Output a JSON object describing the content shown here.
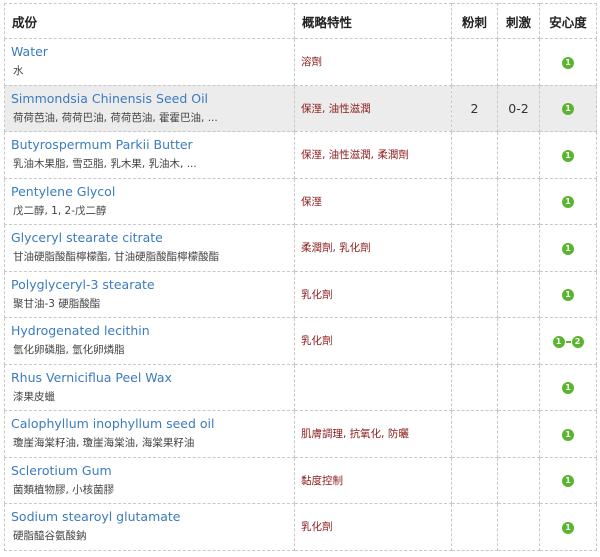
{
  "headers": {
    "ingredient": "成份",
    "properties": "概略特性",
    "acne": "粉刺",
    "irritation": "刺激",
    "safety": "安心度"
  },
  "rows": [
    {
      "name": "Water",
      "alias": "水",
      "props": "溶劑",
      "acne": "",
      "irritation": "",
      "safety": "1",
      "safety_to": ""
    },
    {
      "name": "Simmondsia Chinensis Seed Oil",
      "alias": "荷荷芭油, 荷荷巴油, 荷荷芭油, 霍霍巴油, ...",
      "props": "保溼, 油性滋潤",
      "acne": "2",
      "irritation": "0-2",
      "safety": "1",
      "safety_to": ""
    },
    {
      "name": "Butyrospermum Parkii Butter",
      "alias": "乳油木果脂, 雪亞脂, 乳木果, 乳油木, ...",
      "props": "保溼, 油性滋潤, 柔潤劑",
      "acne": "",
      "irritation": "",
      "safety": "1",
      "safety_to": ""
    },
    {
      "name": "Pentylene Glycol",
      "alias": "戊二醇, 1, 2-戊二醇",
      "props": "保溼",
      "acne": "",
      "irritation": "",
      "safety": "1",
      "safety_to": ""
    },
    {
      "name": "Glyceryl stearate citrate",
      "alias": "甘油硬脂酸酯檸檬酯, 甘油硬脂酸酯檸檬酸酯",
      "props": "柔潤劑, 乳化劑",
      "acne": "",
      "irritation": "",
      "safety": "1",
      "safety_to": ""
    },
    {
      "name": "Polyglyceryl-3 stearate",
      "alias": "聚甘油-3 硬脂酸酯",
      "props": "乳化劑",
      "acne": "",
      "irritation": "",
      "safety": "1",
      "safety_to": ""
    },
    {
      "name": "Hydrogenated lecithin",
      "alias": "氫化卵磷脂, 氫化卵燐脂",
      "props": "乳化劑",
      "acne": "",
      "irritation": "",
      "safety": "1",
      "safety_to": "2"
    },
    {
      "name": "Rhus Verniciflua Peel Wax",
      "alias": "漆果皮蠟",
      "props": "",
      "acne": "",
      "irritation": "",
      "safety": "1",
      "safety_to": ""
    },
    {
      "name": "Calophyllum inophyllum seed oil",
      "alias": "瓊崖海棠籽油, 瓊崖海棠油, 海棠果籽油",
      "props": "肌膚調理, 抗氧化, 防曬",
      "acne": "",
      "irritation": "",
      "safety": "1",
      "safety_to": ""
    },
    {
      "name": "Sclerotium Gum",
      "alias": "菌類植物膠, 小核菌膠",
      "props": "黏度控制",
      "acne": "",
      "irritation": "",
      "safety": "1",
      "safety_to": ""
    },
    {
      "name": "Sodium stearoyl glutamate",
      "alias": "硬脂醯谷氨酸鈉",
      "props": "乳化劑",
      "acne": "",
      "irritation": "",
      "safety": "1",
      "safety_to": ""
    }
  ],
  "colors": {
    "link": "#3b7bbf",
    "property_text": "#8b1a1a",
    "safety_badge": "#5bb430",
    "highlight_row": "#ececec"
  }
}
